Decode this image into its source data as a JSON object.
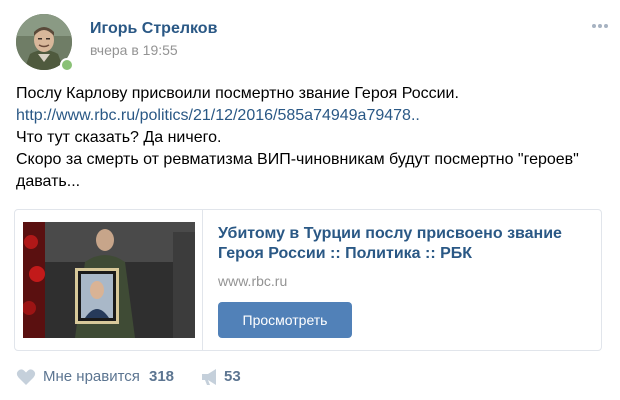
{
  "post": {
    "author": "Игорь Стрелков",
    "time": "вчера в 19:55",
    "text_lines": [
      "Послу Карлову присвоили посмертно звание Героя России.",
      "http://www.rbc.ru/politics/21/12/2016/585a74949a79478..",
      "Что тут сказать? Да ничего.",
      "Скоро за смерть от ревматизма ВИП-чиновникам будут посмертно \"героев\"",
      "давать..."
    ]
  },
  "link_card": {
    "title_lines": [
      "Убитому в Турции послу присвоено звание",
      "Героя России :: Политика :: РБК"
    ],
    "domain": "www.rbc.ru",
    "button_label": "Просмотреть"
  },
  "actions": {
    "like_label": "Мне нравится",
    "like_count": "318",
    "repost_count": "53"
  },
  "icons": {
    "like": "heart-icon",
    "repost": "megaphone-icon",
    "menu": "more-dots-icon"
  },
  "colors": {
    "accent": "#2a5885",
    "button": "#5181b8",
    "muted": "#939393",
    "action": "#5c7591",
    "online": "#8ac176"
  }
}
